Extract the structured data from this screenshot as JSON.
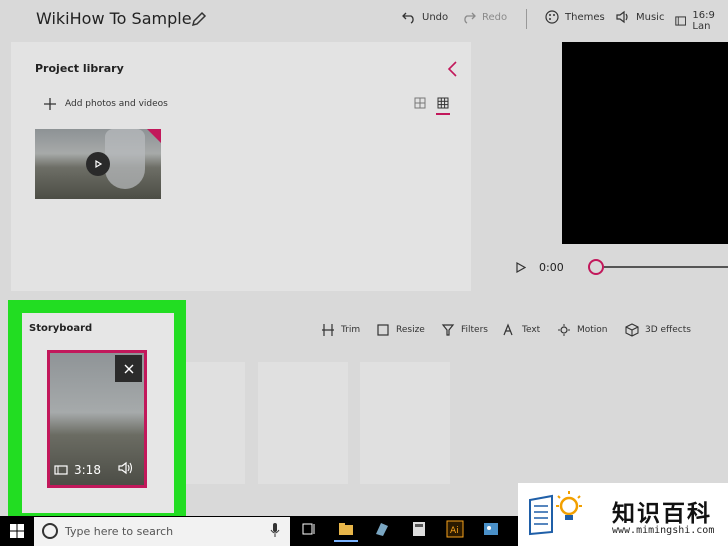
{
  "header": {
    "title": "WikiHow To Sample",
    "undo_label": "Undo",
    "redo_label": "Redo",
    "themes_label": "Themes",
    "music_label": "Music",
    "aspect_label": "16:9 Lan"
  },
  "library": {
    "title": "Project library",
    "add_label": "Add photos and videos"
  },
  "player": {
    "time": "0:00"
  },
  "storyboard": {
    "title": "Storyboard",
    "tools": [
      "Trim",
      "Resize",
      "Filters",
      "Text",
      "Motion",
      "3D effects"
    ],
    "clip_duration": "3:18"
  },
  "taskbar": {
    "search_placeholder": "Type here to search"
  },
  "watermark": {
    "chinese": "知识百科",
    "url": "www.mimingshi.com"
  },
  "colors": {
    "accent": "#c2185b",
    "highlight": "#22dd22"
  }
}
